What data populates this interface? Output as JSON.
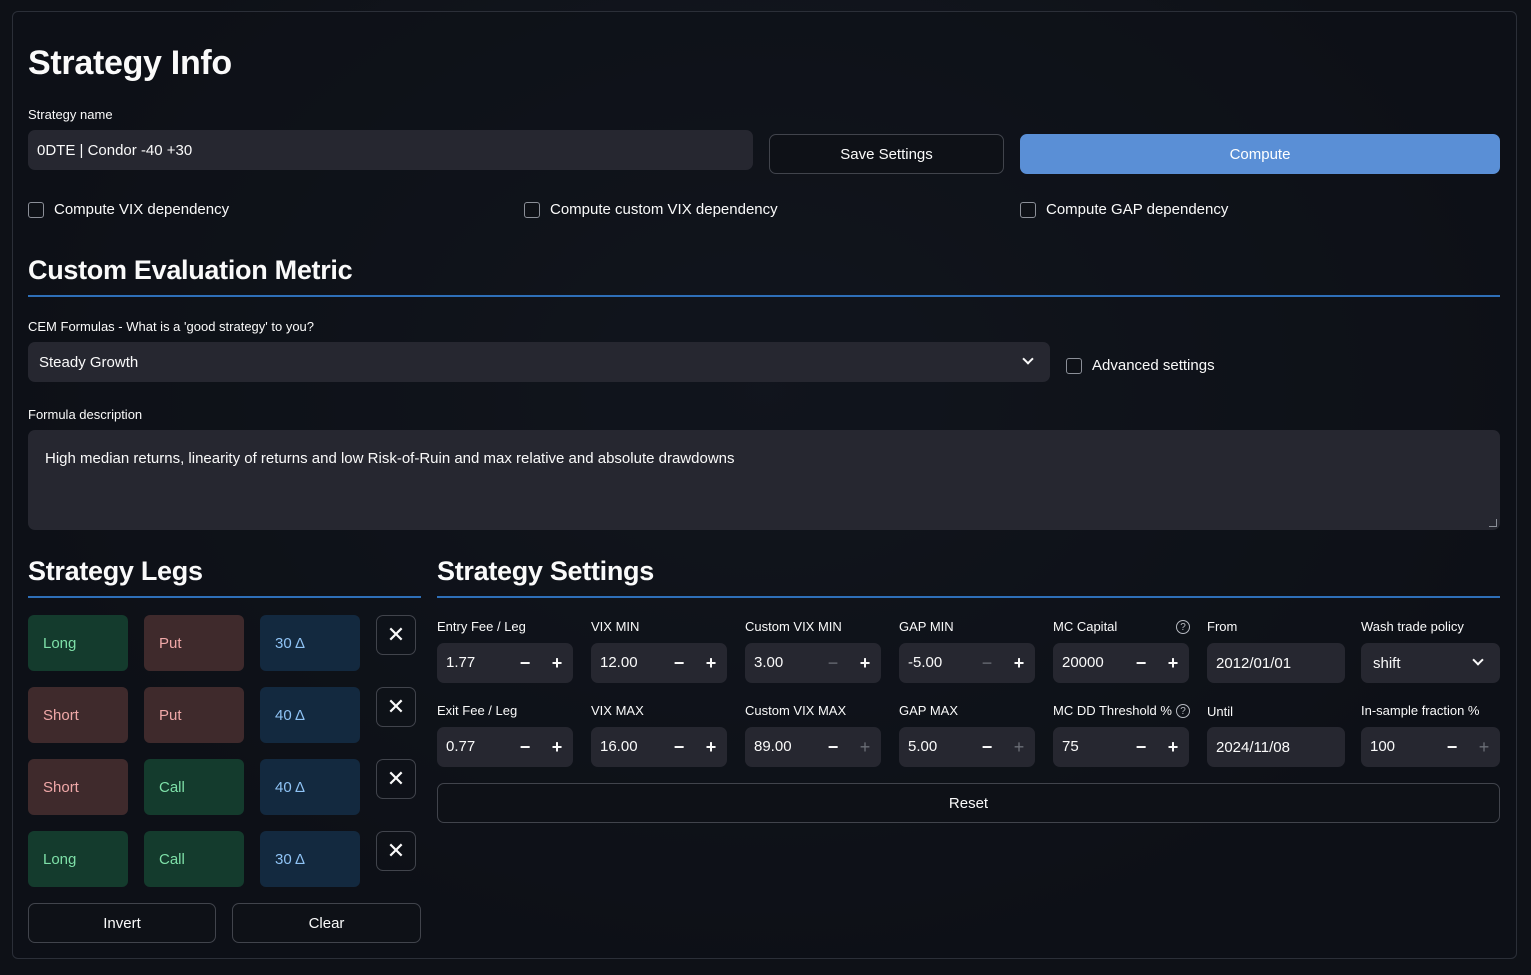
{
  "strategy_info": {
    "title": "Strategy Info",
    "name_label": "Strategy name",
    "name_value": "0DTE | Condor -40 +30",
    "save_label": "Save Settings",
    "compute_label": "Compute",
    "checks": [
      "Compute VIX dependency",
      "Compute custom VIX dependency",
      "Compute GAP dependency"
    ]
  },
  "cem": {
    "title": "Custom Evaluation Metric",
    "formula_label": "CEM Formulas - What is a 'good strategy' to you?",
    "formula_value": "Steady Growth",
    "advanced_label": "Advanced settings",
    "description_label": "Formula description",
    "description_value": "High median returns, linearity of returns and low Risk-of-Ruin and max relative and absolute drawdowns"
  },
  "legs": {
    "title": "Strategy Legs",
    "rows": [
      {
        "side": "Long",
        "type": "Put",
        "delta": "30 Δ"
      },
      {
        "side": "Short",
        "type": "Put",
        "delta": "40 Δ"
      },
      {
        "side": "Short",
        "type": "Call",
        "delta": "40 Δ"
      },
      {
        "side": "Long",
        "type": "Call",
        "delta": "30 Δ"
      }
    ],
    "remove_symbol": "✕",
    "invert_label": "Invert",
    "clear_label": "Clear"
  },
  "settings": {
    "title": "Strategy Settings",
    "entry_fee": {
      "label": "Entry Fee / Leg",
      "value": "1.77"
    },
    "exit_fee": {
      "label": "Exit Fee / Leg",
      "value": "0.77"
    },
    "vix_min": {
      "label": "VIX MIN",
      "value": "12.00"
    },
    "vix_max": {
      "label": "VIX MAX",
      "value": "16.00"
    },
    "cvix_min": {
      "label": "Custom VIX MIN",
      "value": "3.00"
    },
    "cvix_max": {
      "label": "Custom VIX MAX",
      "value": "89.00"
    },
    "gap_min": {
      "label": "GAP MIN",
      "value": "-5.00"
    },
    "gap_max": {
      "label": "GAP MAX",
      "value": "5.00"
    },
    "mc_capital": {
      "label": "MC Capital",
      "value": "20000"
    },
    "mc_dd": {
      "label": "MC DD Threshold %",
      "value": "75"
    },
    "from": {
      "label": "From",
      "value": "2012/01/01"
    },
    "until": {
      "label": "Until",
      "value": "2024/11/08"
    },
    "wash": {
      "label": "Wash trade policy",
      "value": "shift"
    },
    "insample": {
      "label": "In-sample fraction %",
      "value": "100"
    },
    "reset_label": "Reset",
    "minus": "−",
    "plus": "+",
    "help": "?"
  }
}
